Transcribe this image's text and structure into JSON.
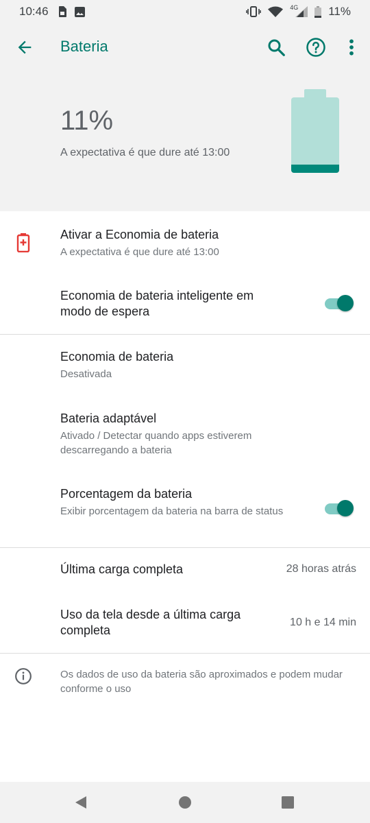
{
  "status_bar": {
    "time": "10:46",
    "network": "4G",
    "battery": "11%"
  },
  "app_bar": {
    "title": "Bateria"
  },
  "header": {
    "percentage": "11%",
    "estimate": "A expectativa é que dure até 13:00",
    "battery_level": 0.11,
    "colors": {
      "accent": "#00796b",
      "battery_empty": "#b2dfd8",
      "battery_fill": "#00897b"
    }
  },
  "settings": {
    "saver_activate": {
      "title": "Ativar a Economia de bateria",
      "subtitle": "A expectativa é que dure até 13:00"
    },
    "smart_standby": {
      "title": "Economia de bateria inteligente em modo de espera",
      "enabled": true
    },
    "battery_saver": {
      "title": "Economia de bateria",
      "subtitle": "Desativada"
    },
    "adaptive": {
      "title": "Bateria adaptável",
      "subtitle": "Ativado / Detectar quando apps estiverem descarregando a bateria"
    },
    "percentage": {
      "title": "Porcentagem da bateria",
      "subtitle": "Exibir porcentagem da bateria na barra de status",
      "enabled": true
    },
    "last_charge": {
      "title": "Última carga completa",
      "value": "28 horas atrás"
    },
    "screen_usage": {
      "title": "Uso da tela desde a última carga completa",
      "value": "10 h e 14 min"
    }
  },
  "footer_note": "Os dados de uso da bateria são aproximados e podem mudar conforme o uso"
}
